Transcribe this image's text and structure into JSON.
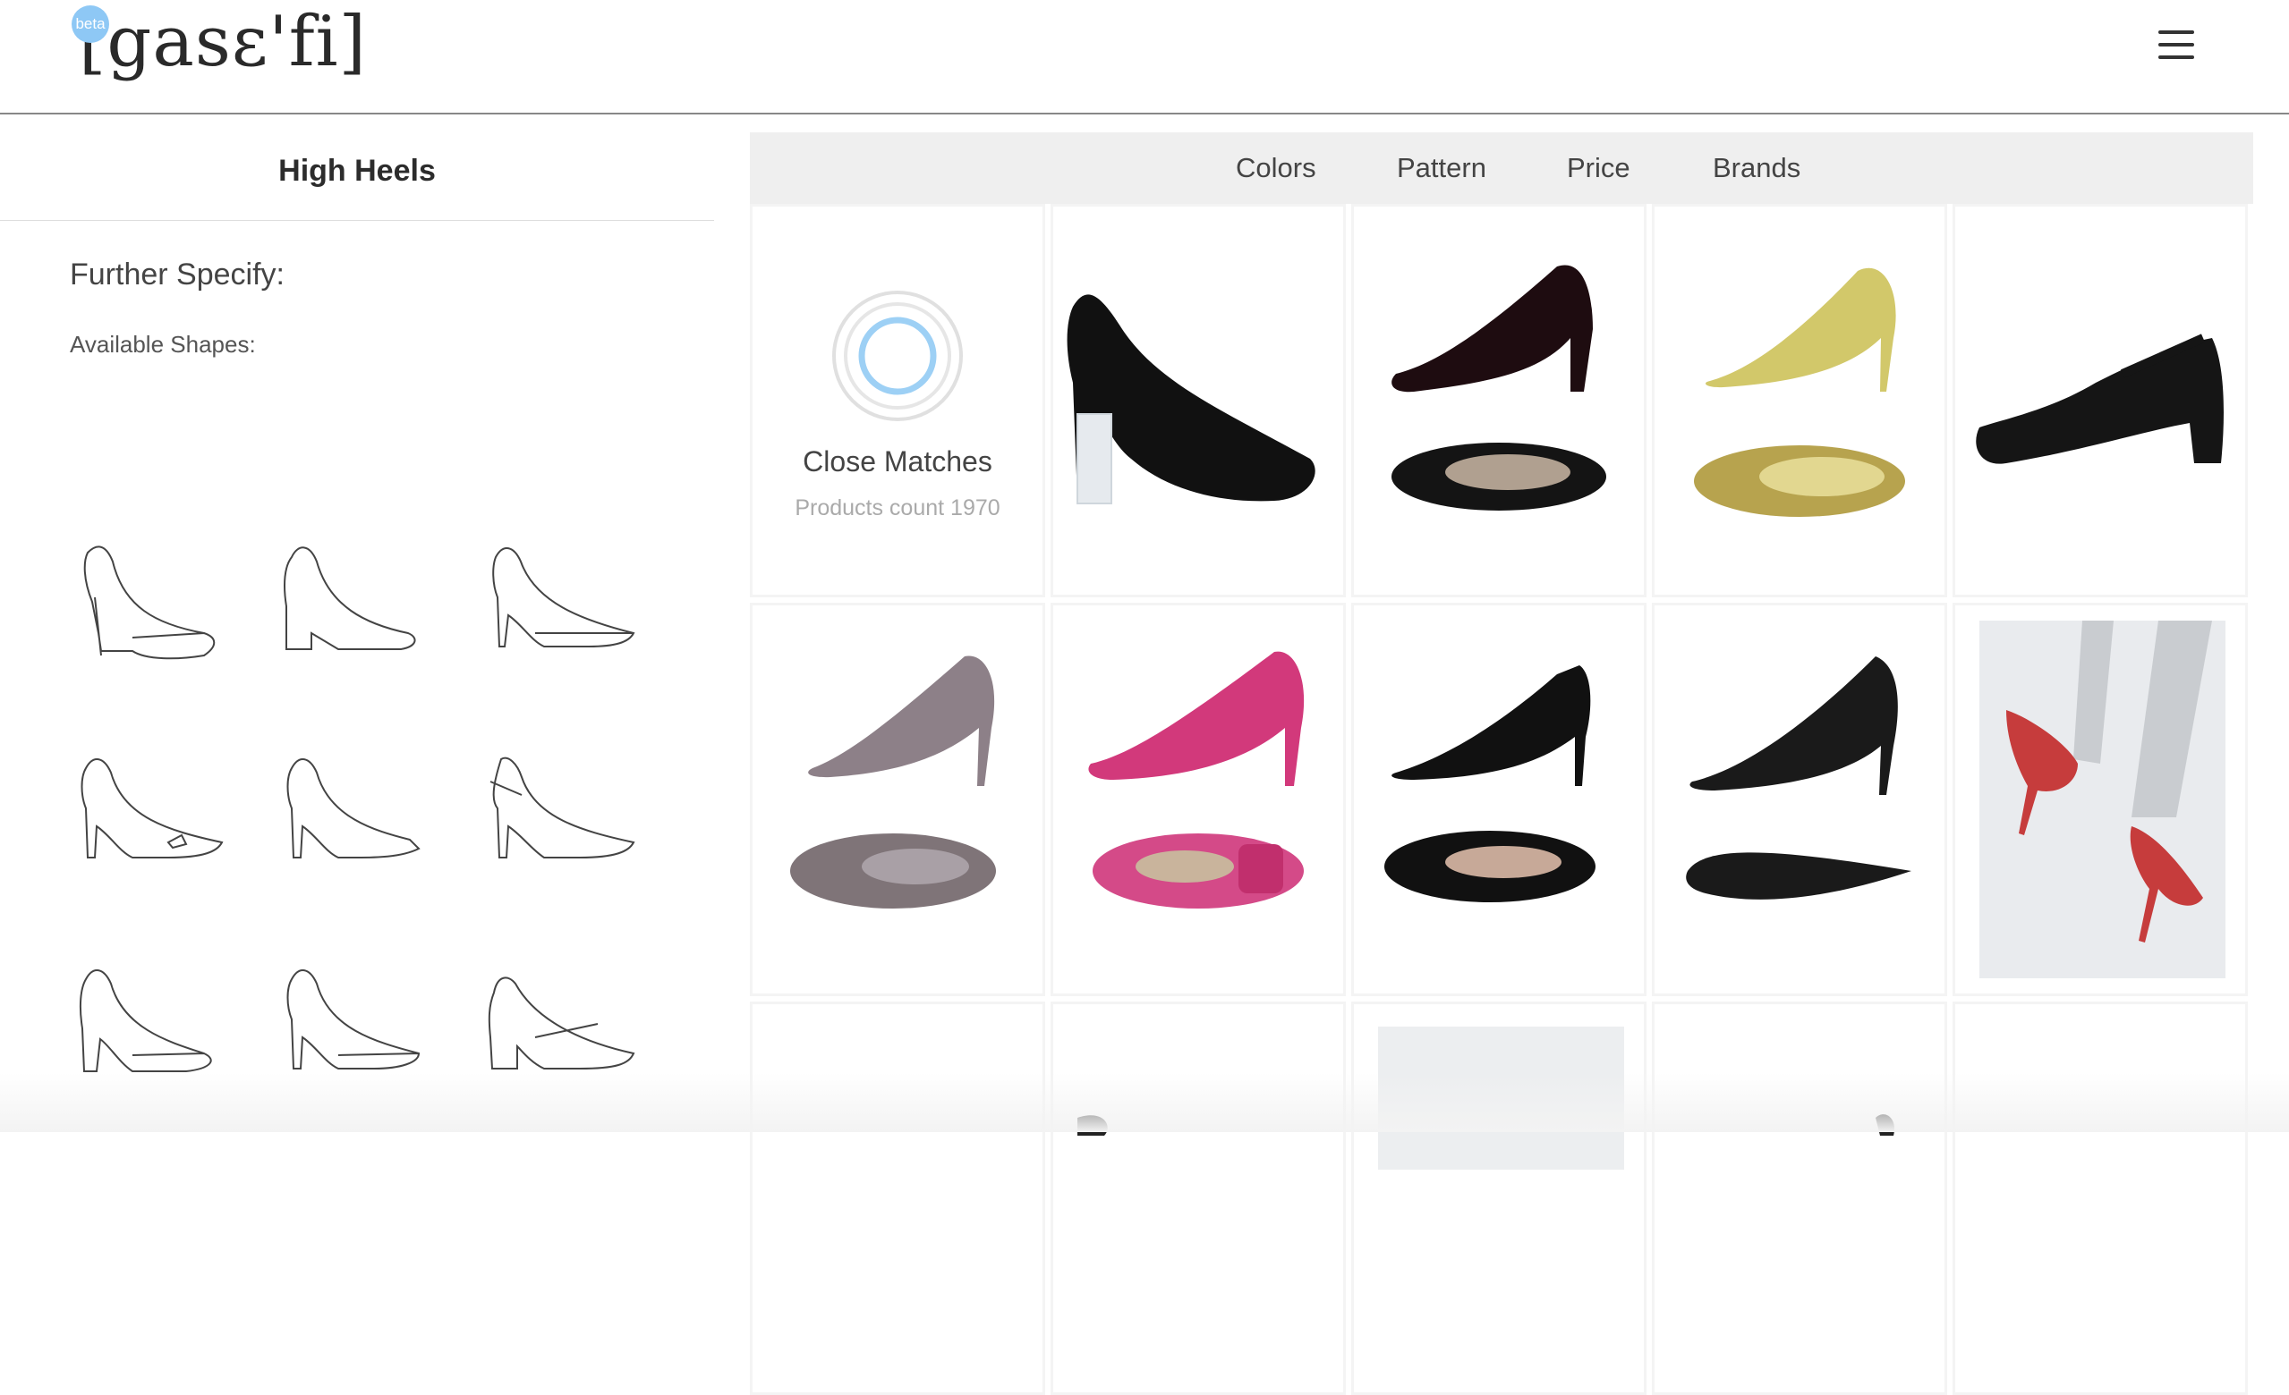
{
  "header": {
    "logo_text": "[gasɛ'fi]",
    "beta_label": "beta"
  },
  "sidebar": {
    "title": "High Heels",
    "further_specify": "Further Specify:",
    "available_shapes": "Available Shapes:",
    "shapes": [
      {
        "name": "classic-pump-platform"
      },
      {
        "name": "block-heel-pump"
      },
      {
        "name": "slingback-pointed"
      },
      {
        "name": "pump-with-bow"
      },
      {
        "name": "peep-toe-pump"
      },
      {
        "name": "ankle-strap-slingback"
      },
      {
        "name": "block-heel-rounded"
      },
      {
        "name": "stiletto-pointed"
      },
      {
        "name": "mary-jane-block"
      }
    ]
  },
  "filters": {
    "colors": "Colors",
    "pattern": "Pattern",
    "price": "Price",
    "brands": "Brands"
  },
  "close_matches": {
    "title": "Close Matches",
    "count_label": "Products count 1970"
  },
  "products": [
    {
      "name": "black-suede-clear-heel-pump",
      "color": "#111111"
    },
    {
      "name": "burgundy-patent-pump",
      "color": "#2a0f14"
    },
    {
      "name": "yellow-suede-peep-toe",
      "color": "#c8c050"
    },
    {
      "name": "black-mary-jane-block",
      "color": "#151515"
    },
    {
      "name": "grey-snakeskin-peep-toe",
      "color": "#8a7f86"
    },
    {
      "name": "pink-suede-buckle-pump",
      "color": "#d2387a"
    },
    {
      "name": "black-slingback-peep-toe",
      "color": "#101010"
    },
    {
      "name": "black-pointed-dorsay",
      "color": "#1a1a1a"
    },
    {
      "name": "red-pointed-pump-model",
      "color": "#c93a3a"
    }
  ]
}
